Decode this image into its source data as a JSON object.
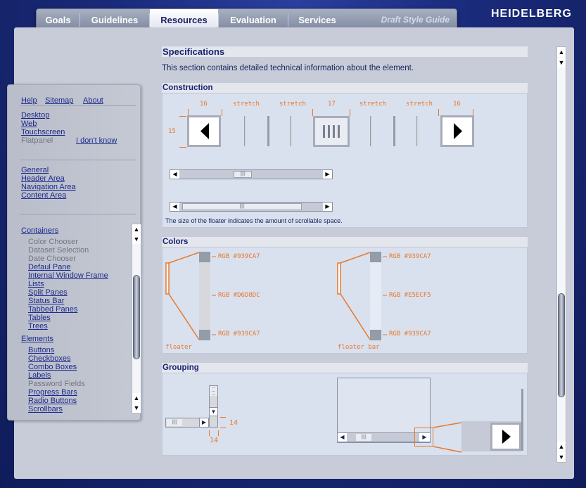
{
  "nav": {
    "tabs": [
      "Goals",
      "Guidelines",
      "Resources",
      "Evaluation",
      "Services"
    ],
    "active": "Resources",
    "draft_label": "Draft Style Guide",
    "logo": "HEIDELBERG"
  },
  "sidebar": {
    "top_links": [
      "Help",
      "Sitemap",
      "About"
    ],
    "platforms": [
      "Desktop",
      "Web",
      "Touchscreen"
    ],
    "platform_disabled": "Flatpanel",
    "dont_know": "I don't know",
    "areas": [
      "General",
      "Header Area",
      "Navigation Area",
      "Content Area"
    ],
    "containers_heading": "Containers",
    "containers": [
      {
        "label": "Color Chooser",
        "disabled": true
      },
      {
        "label": "Dataset Selection",
        "disabled": true
      },
      {
        "label": "Date Chooser",
        "disabled": true
      },
      {
        "label": "Defaul Pane",
        "disabled": false
      },
      {
        "label": "Internal Window Frame",
        "disabled": false
      },
      {
        "label": "Lists",
        "disabled": false
      },
      {
        "label": "Split Panes",
        "disabled": false
      },
      {
        "label": "Status Bar",
        "disabled": false
      },
      {
        "label": "Tabbed Panes",
        "disabled": false
      },
      {
        "label": "Tables",
        "disabled": false
      },
      {
        "label": "Trees",
        "disabled": false
      }
    ],
    "elements_heading": "Elements",
    "elements": [
      {
        "label": "Buttons",
        "disabled": false
      },
      {
        "label": "Checkboxes",
        "disabled": false
      },
      {
        "label": "Combo Boxes",
        "disabled": false
      },
      {
        "label": "Labels",
        "disabled": false
      },
      {
        "label": "Password Fields",
        "disabled": true
      },
      {
        "label": "Progress Bars",
        "disabled": false
      },
      {
        "label": "Radio Buttons",
        "disabled": false
      },
      {
        "label": "Scrollbars",
        "disabled": false
      }
    ]
  },
  "content": {
    "title": "Specifications",
    "intro": "This section contains detailed technical information about the element.",
    "construction": {
      "heading": "Construction",
      "dims": [
        "16",
        "stretch",
        "stretch",
        "17",
        "stretch",
        "stretch",
        "16"
      ],
      "height_label": "15",
      "note": "The size of the floater indicates the amount of scrollable space."
    },
    "colors": {
      "heading": "Colors",
      "left": {
        "top": "RGB #939CA7",
        "middle": "RGB #D6D8DC",
        "bottom": "RGB #939CA7",
        "caption": "floater"
      },
      "right": {
        "top": "RGB #939CA7",
        "middle": "RGB #E5ECF5",
        "bottom": "RGB #939CA7",
        "caption": "floater bar"
      }
    },
    "grouping": {
      "heading": "Grouping",
      "w_label": "14",
      "h_label": "14"
    }
  },
  "colors_hex": {
    "accent": "#e8792c",
    "nav_active": "#ffffff",
    "link": "#1c2a8c"
  }
}
